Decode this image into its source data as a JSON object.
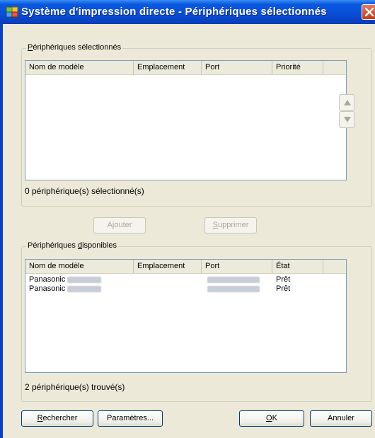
{
  "window": {
    "title": "Système d'impression directe - Périphériques sélectionnés",
    "icon": "printer-app-icon"
  },
  "selected_group": {
    "label_first": "P",
    "label_rest": "ériphériques sélectionnés",
    "columns": [
      "Nom de modèle",
      "Emplacement",
      "Port",
      "Priorité"
    ],
    "rows": [],
    "status": "0 périphérique(s) sélectionné(s)"
  },
  "move_buttons": {
    "up_icon": "arrow-up-icon",
    "down_icon": "arrow-down-icon"
  },
  "actions": {
    "add_label": "Ajouter",
    "remove_first": "S",
    "remove_rest": "upprimer"
  },
  "available_group": {
    "label_before": "Périphériques ",
    "label_ul": "d",
    "label_after": "isponibles",
    "columns": [
      "Nom de modèle",
      "Emplacement",
      "Port",
      "État"
    ],
    "rows": [
      {
        "model": "Panasonic",
        "location": "",
        "port": "",
        "state": "Prêt"
      },
      {
        "model": "Panasonic",
        "location": "",
        "port": "",
        "state": "Prêt"
      }
    ],
    "status": "2 périphérique(s) trouvé(s)"
  },
  "footer": {
    "search_first": "R",
    "search_rest": "echercher",
    "settings_label": "Paramètres...",
    "ok_first": "O",
    "ok_rest": "K",
    "cancel_label": "Annuler"
  }
}
